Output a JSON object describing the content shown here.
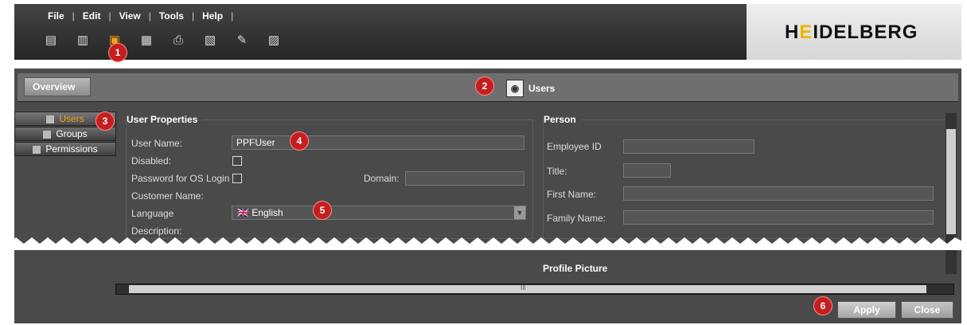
{
  "menubar": {
    "items": [
      "File",
      "Edit",
      "View",
      "Tools",
      "Help"
    ]
  },
  "brand": {
    "name_left": "H",
    "name_accent": "E",
    "name_right": "IDELBERG"
  },
  "header": {
    "overview_label": "Overview",
    "title": "Users"
  },
  "nav": {
    "items": [
      "Users",
      "Groups",
      "Permissions"
    ]
  },
  "user_properties": {
    "title": "User Properties",
    "user_name_label": "User Name:",
    "user_name_value": "PPFUser",
    "disabled_label": "Disabled:",
    "password_label": "Password for OS Login",
    "domain_label": "Domain:",
    "customer_label": "Customer Name:",
    "language_label": "Language",
    "language_value": "English",
    "description_label": "Description:"
  },
  "person": {
    "title": "Person",
    "employee_label": "Employee ID",
    "title_label": "Title:",
    "first_label": "First Name:",
    "family_label": "Family Name:"
  },
  "profile": {
    "title": "Profile Picture"
  },
  "buttons": {
    "apply": "Apply",
    "close": "Close"
  },
  "badges": [
    "1",
    "2",
    "3",
    "4",
    "5",
    "6"
  ],
  "scroll": {
    "grip": "III"
  }
}
